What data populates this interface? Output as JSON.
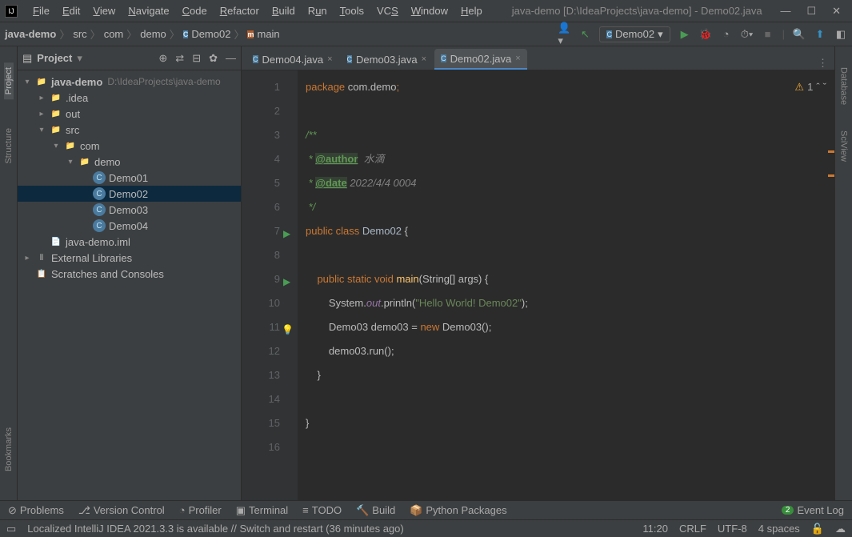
{
  "window": {
    "title": "java-demo [D:\\IdeaProjects\\java-demo] - Demo02.java"
  },
  "menu": [
    "File",
    "Edit",
    "View",
    "Navigate",
    "Code",
    "Refactor",
    "Build",
    "Run",
    "Tools",
    "VCS",
    "Window",
    "Help"
  ],
  "breadcrumb": [
    "java-demo",
    "src",
    "com",
    "demo",
    "Demo02",
    "main"
  ],
  "runConfig": "Demo02",
  "sidebar": {
    "title": "Project",
    "root": {
      "name": "java-demo",
      "path": "D:\\IdeaProjects\\java-demo"
    },
    "idea": ".idea",
    "out": "out",
    "src": "src",
    "com": "com",
    "demo": "demo",
    "files": [
      "Demo01",
      "Demo02",
      "Demo03",
      "Demo04"
    ],
    "iml": "java-demo.iml",
    "ext": "External Libraries",
    "scratch": "Scratches and Consoles"
  },
  "tabs": [
    {
      "label": "Demo04.java"
    },
    {
      "label": "Demo03.java"
    },
    {
      "label": "Demo02.java"
    }
  ],
  "code": {
    "l1_pkg": "package ",
    "l1_path": "com.demo",
    "l1_semi": ";",
    "l3": "/**",
    "l4_pre": " * ",
    "l4_tag": "@author",
    "l4_txt": "  水滴",
    "l5_pre": " * ",
    "l5_tag": "@date",
    "l5_txt": " 2022/4/4 0004",
    "l6": " */",
    "l7_pub": "public class ",
    "l7_cls": "Demo02",
    "l7_open": " {",
    "l9_ind": "    ",
    "l9_mod": "public static void ",
    "l9_m": "main",
    "l9_args": "(String[] args) {",
    "l10_ind": "        ",
    "l10_sys": "System.",
    "l10_out": "out",
    "l10_pr": ".println(",
    "l10_s": "\"Hello World! Demo02\"",
    "l10_end": ");",
    "l11_ind": "        ",
    "l11_t": "Demo03 demo03 = ",
    "l11_new": "new ",
    "l11_c": "Demo03();",
    "l12_ind": "        ",
    "l12": "demo03.run();",
    "l13": "    }",
    "l15": "}"
  },
  "warnings": "1",
  "bottomTools": [
    "Problems",
    "Version Control",
    "Profiler",
    "Terminal",
    "TODO",
    "Build",
    "Python Packages"
  ],
  "eventLog": "Event Log",
  "status": {
    "msg": "Localized IntelliJ IDEA 2021.3.3 is available // Switch and restart (36 minutes ago)",
    "time": "11:20",
    "sep": "CRLF",
    "enc": "UTF-8",
    "indent": "4 spaces"
  },
  "leftTools": [
    "Project",
    "Structure",
    "Bookmarks"
  ],
  "rightTools": [
    "Database",
    "SciView"
  ]
}
